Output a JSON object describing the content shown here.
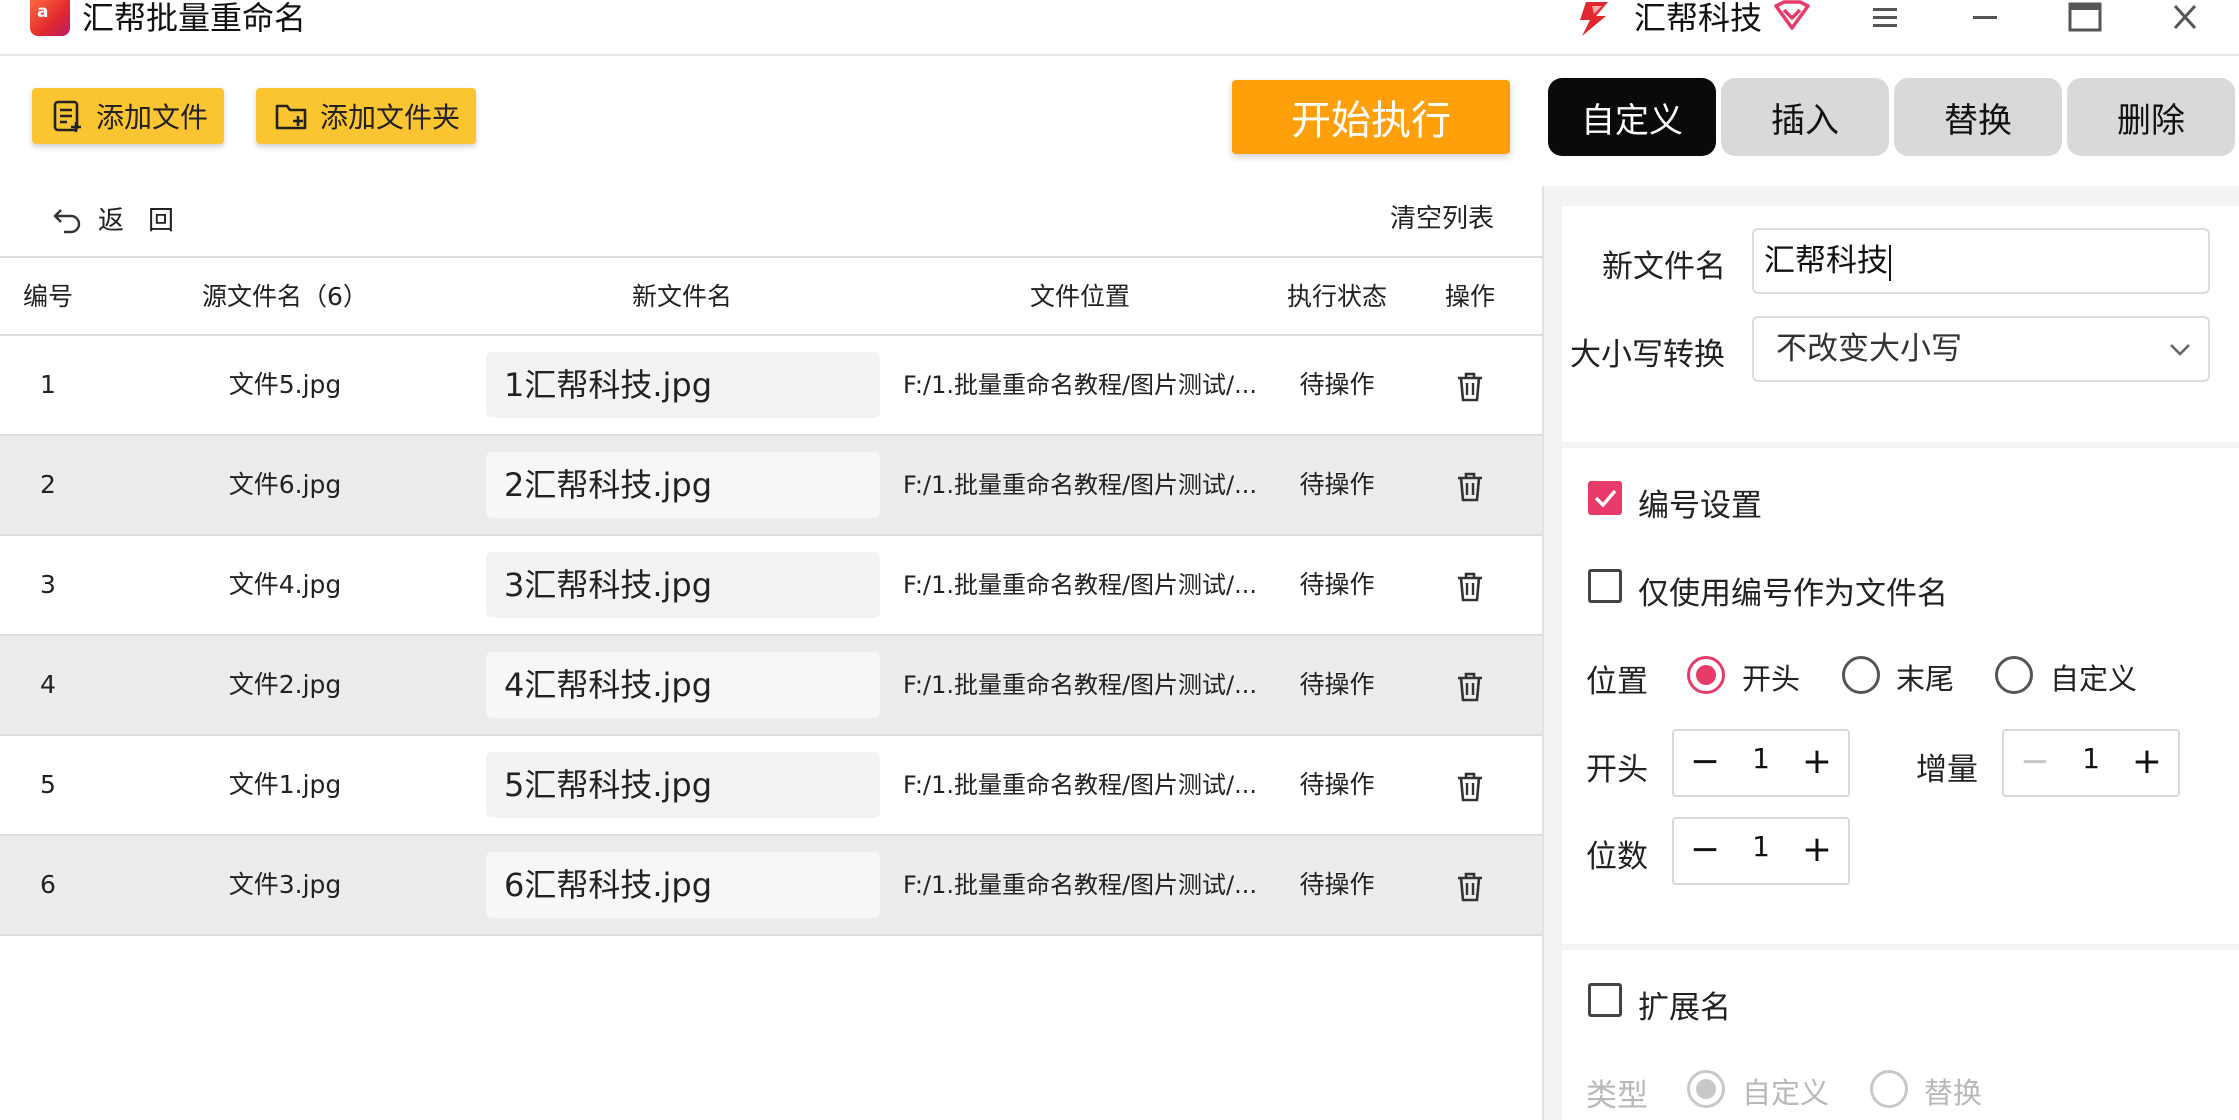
{
  "titlebar": {
    "app_title": "汇帮批量重命名",
    "brand_name": "汇帮科技"
  },
  "toolbar": {
    "add_file": "添加文件",
    "add_folder": "添加文件夹",
    "start": "开始执行"
  },
  "tabs": [
    {
      "label": "自定义",
      "active": true
    },
    {
      "label": "插入",
      "active": false
    },
    {
      "label": "替换",
      "active": false
    },
    {
      "label": "删除",
      "active": false
    }
  ],
  "list": {
    "back": "返回",
    "clear": "清空列表",
    "columns": [
      "编号",
      "源文件名（6）",
      "新文件名",
      "文件位置",
      "执行状态",
      "操作"
    ],
    "rows": [
      {
        "num": "1",
        "source": "文件5.jpg",
        "new_name": "1汇帮科技.jpg",
        "path": "F:/1.批量重命名教程/图片测试/...",
        "status": "待操作"
      },
      {
        "num": "2",
        "source": "文件6.jpg",
        "new_name": "2汇帮科技.jpg",
        "path": "F:/1.批量重命名教程/图片测试/...",
        "status": "待操作"
      },
      {
        "num": "3",
        "source": "文件4.jpg",
        "new_name": "3汇帮科技.jpg",
        "path": "F:/1.批量重命名教程/图片测试/...",
        "status": "待操作"
      },
      {
        "num": "4",
        "source": "文件2.jpg",
        "new_name": "4汇帮科技.jpg",
        "path": "F:/1.批量重命名教程/图片测试/...",
        "status": "待操作"
      },
      {
        "num": "5",
        "source": "文件1.jpg",
        "new_name": "5汇帮科技.jpg",
        "path": "F:/1.批量重命名教程/图片测试/...",
        "status": "待操作"
      },
      {
        "num": "6",
        "source": "文件3.jpg",
        "new_name": "6汇帮科技.jpg",
        "path": "F:/1.批量重命名教程/图片测试/...",
        "status": "待操作"
      }
    ]
  },
  "panel": {
    "new_name_label": "新文件名",
    "new_name_value": "汇帮科技",
    "case_label": "大小写转换",
    "case_value": "不改变大小写",
    "numbering_label": "编号设置",
    "numbering_checked": true,
    "only_number_label": "仅使用编号作为文件名",
    "only_number_checked": false,
    "position_label": "位置",
    "position_options": [
      "开头",
      "末尾",
      "自定义"
    ],
    "position_selected": "开头",
    "start_label": "开头",
    "start_value": "1",
    "increment_label": "增量",
    "increment_value": "1",
    "digits_label": "位数",
    "digits_value": "1",
    "extension_label": "扩展名",
    "extension_checked": false,
    "type_label": "类型",
    "type_options": [
      "自定义",
      "替换"
    ],
    "type_selected": "自定义"
  },
  "colors": {
    "toolbar_button": "#fbc531",
    "start_button": "#ff9f0a",
    "tab_active": "#0a0a0a",
    "tab_inactive": "#d9d9d9",
    "accent": "#e83b6a"
  }
}
